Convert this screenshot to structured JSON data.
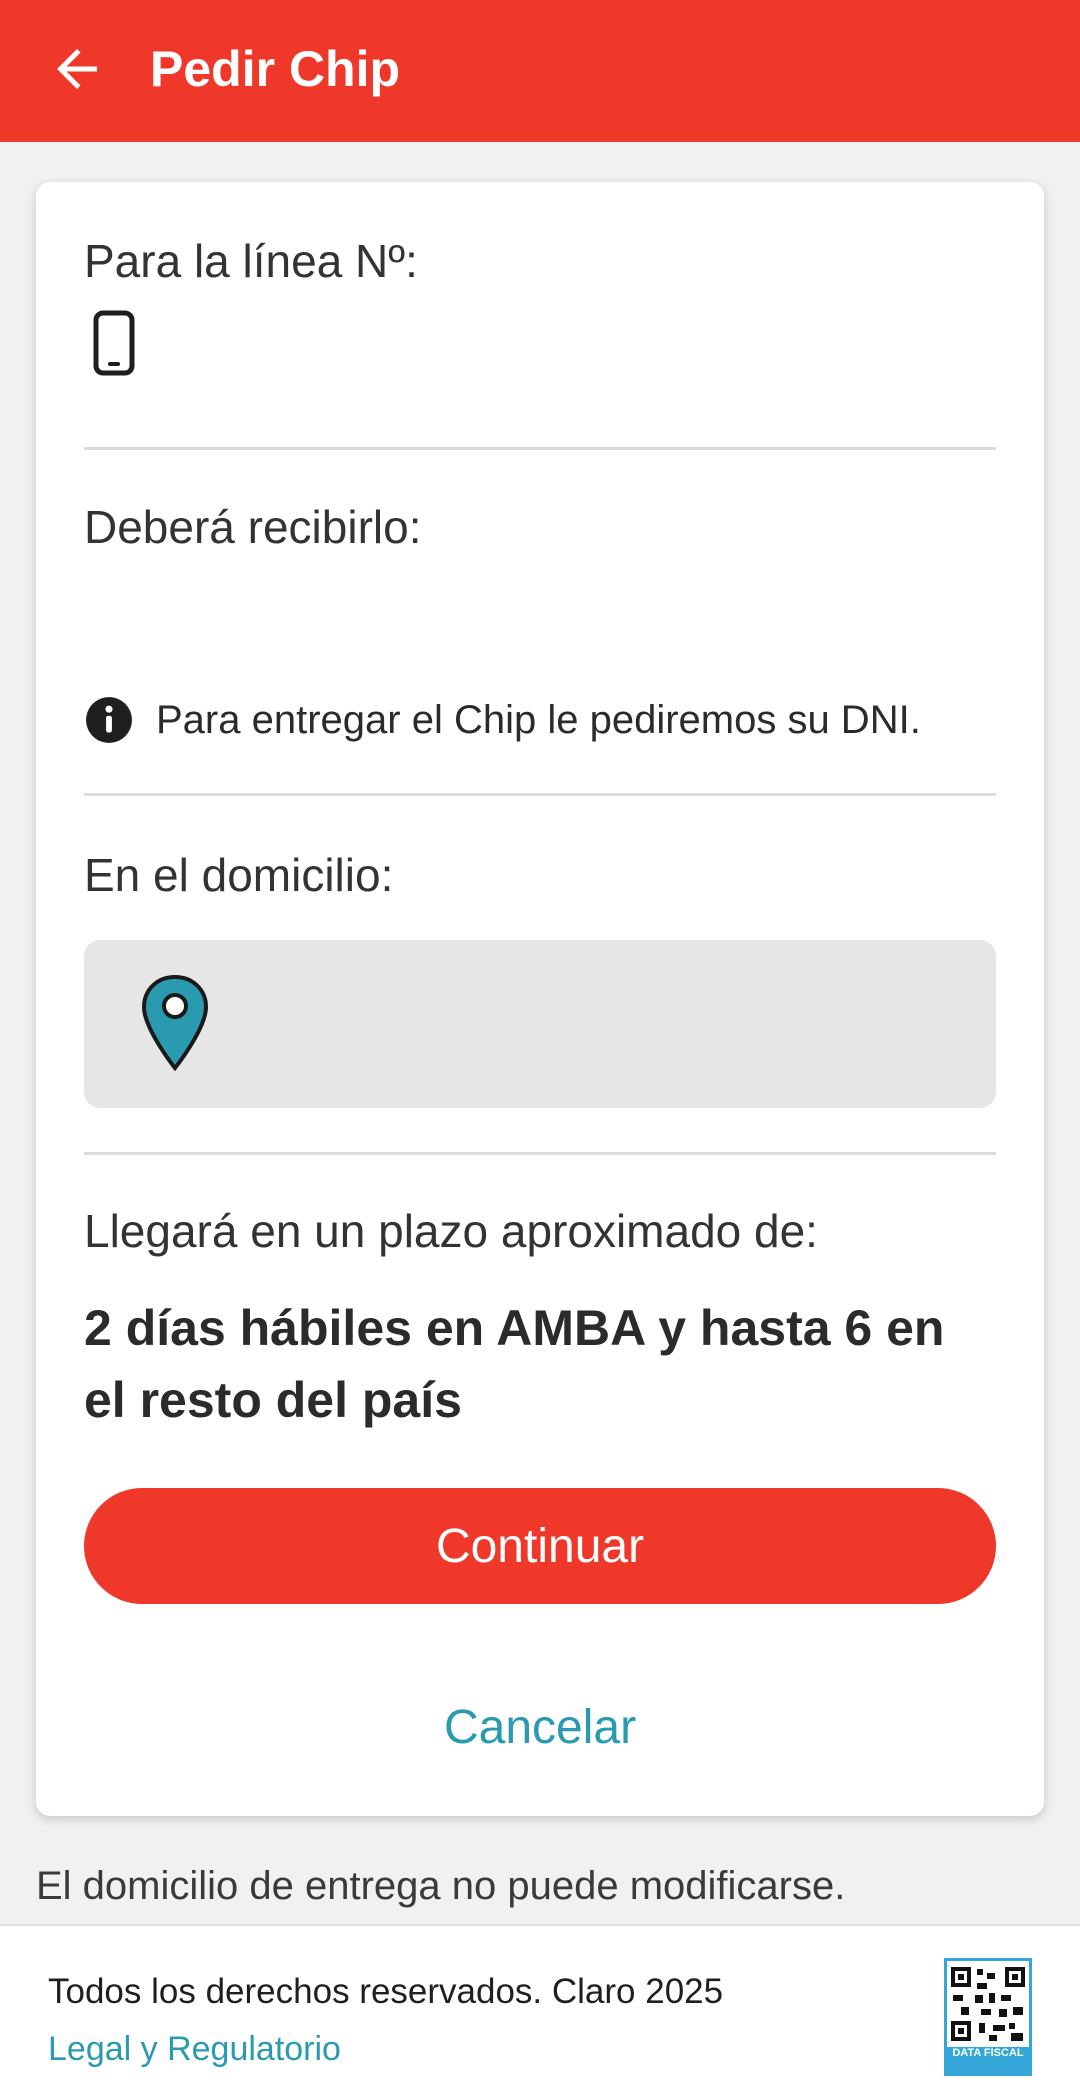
{
  "header": {
    "title": "Pedir Chip",
    "back_icon": "arrow-left-icon",
    "bg_color": "#ef3829"
  },
  "card": {
    "line_label": "Para la línea Nº:",
    "phone_icon": "phone-icon",
    "receive_label": "Deberá recibirlo:",
    "info_icon": "info-icon",
    "info_text": "Para entregar el Chip le pediremos su DNI.",
    "address_label": "En el domicilio:",
    "pin_icon": "location-pin-icon",
    "eta_label": "Llegará en un plazo aproximado de:",
    "eta_value": "2 días hábiles en AMBA y hasta 6 en el resto del país",
    "continue_label": "Continuar",
    "cancel_label": "Cancelar"
  },
  "note": "El domicilio de entrega no puede modificarse.",
  "footer": {
    "rights": "Todos los derechos reservados. Claro 2025",
    "legal_link": "Legal y Regulatorio",
    "qr_caption": "DATA FISCAL",
    "link_color": "#2a9ab0"
  }
}
